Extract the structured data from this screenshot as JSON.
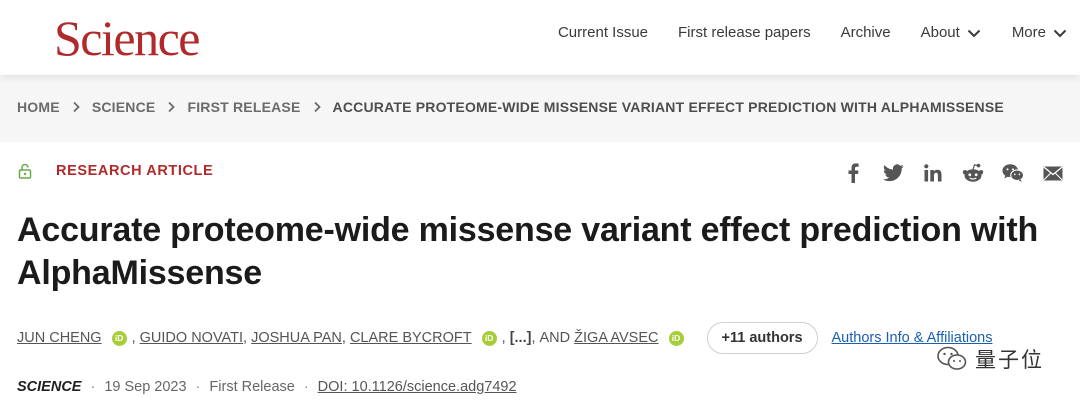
{
  "header": {
    "logo": "Science",
    "nav": [
      {
        "label": "Current Issue"
      },
      {
        "label": "First release papers"
      },
      {
        "label": "Archive"
      },
      {
        "label": "About",
        "has_dropdown": true
      },
      {
        "label": "More",
        "has_dropdown": true
      }
    ]
  },
  "breadcrumb": [
    "HOME",
    "SCIENCE",
    "FIRST RELEASE",
    "ACCURATE PROTEOME-WIDE MISSENSE VARIANT EFFECT PREDICTION WITH ALPHAMISSENSE"
  ],
  "article": {
    "type": "RESEARCH ARTICLE",
    "title": "Accurate proteome-wide missense variant effect prediction with AlphaMissense",
    "share_icons": [
      "facebook-icon",
      "twitter-icon",
      "linkedin-icon",
      "reddit-icon",
      "wechat-icon",
      "email-icon"
    ],
    "authors": [
      "JUN CHENG",
      "GUIDO NOVATI",
      "JOSHUA PAN",
      "CLARE BYCROFT",
      "ŽIGA AVSEC"
    ],
    "orcid_label": "iD",
    "ellipsis": "[...]",
    "and_label": "AND",
    "more_authors": "+11 authors",
    "affiliations_link": "Authors Info & Affiliations",
    "journal": "SCIENCE",
    "date": "19 Sep 2023",
    "release": "First Release",
    "doi": "DOI: 10.1126/science.adg7492"
  },
  "watermark": {
    "text": "量子位"
  },
  "colors": {
    "brand": "#b0292b",
    "orcid": "#a6ce39",
    "link": "#1a5fb4"
  }
}
